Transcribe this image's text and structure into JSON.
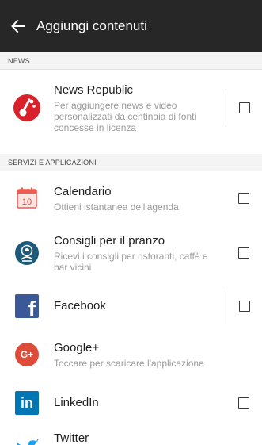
{
  "appbar": {
    "title": "Aggiungi contenuti",
    "back_icon": "arrow-left-icon"
  },
  "sections": [
    {
      "header": "NEWS"
    },
    {
      "header": "SERVIZI E APPLICAZIONI"
    }
  ],
  "items": [
    {
      "name": "News Republic",
      "desc": "Per aggiungere news e video personalizzati da centinaia di fonti concesse in licenza",
      "icon": "news-republic-icon",
      "has_checkbox": true
    },
    {
      "name": "Calendario",
      "desc": "Ottieni istantanea dell'agenda",
      "icon": "calendar-icon",
      "calendar_day": "10",
      "has_checkbox": true
    },
    {
      "name": "Consigli per il pranzo",
      "desc": "Ricevi i consigli per ristoranti, caffè e bar vicini",
      "icon": "lunch-tips-icon",
      "has_checkbox": true
    },
    {
      "name": "Facebook",
      "desc": "",
      "icon": "facebook-icon",
      "glyph": "f",
      "has_checkbox": true
    },
    {
      "name": "Google+",
      "desc": "Toccare per scaricare l'applicazione",
      "icon": "google-plus-icon",
      "glyph": "G+",
      "has_checkbox": false
    },
    {
      "name": "LinkedIn",
      "desc": "",
      "icon": "linkedin-icon",
      "glyph": "in",
      "has_checkbox": true
    },
    {
      "name": "Twitter",
      "desc": "",
      "icon": "twitter-icon",
      "has_checkbox": false
    }
  ],
  "colors": {
    "appbar": "#272727",
    "news_republic": "#d8212a",
    "calendar": "#ef5b50",
    "lunch": "#1c5a7a",
    "facebook": "#3b5998",
    "google_plus": "#dd4b39",
    "linkedin": "#0077b5",
    "twitter": "#1da1f2"
  }
}
